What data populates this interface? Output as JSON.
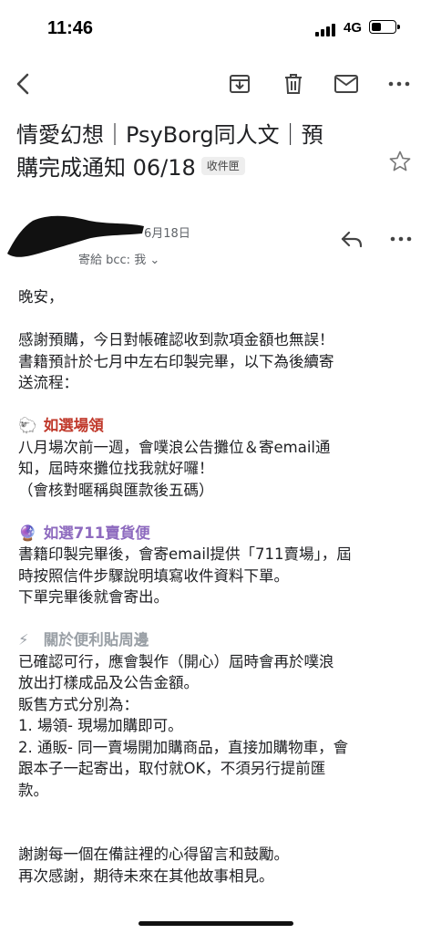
{
  "status_bar": {
    "time": "11:46",
    "network": "4G",
    "battery_level": 0.45
  },
  "toolbar": {
    "back_icon": "back-arrow-icon",
    "archive_icon": "archive-icon",
    "delete_icon": "trash-icon",
    "mark_unread_icon": "mail-icon",
    "more_icon": "more-horizontal-icon"
  },
  "email": {
    "subject_line1": "情愛幻想｜PsyBorg同人文｜預",
    "subject_line2": "購完成通知 06/18",
    "label": "收件匣",
    "date": "6月18日",
    "recipients": "寄給 bcc: 我 ⌄",
    "body": {
      "greeting": "晚安，",
      "intro": [
        "感謝預購，今日對帳確認收到款項金額也無誤！",
        "書籍預計於七月中左右印製完畢，以下為後續寄",
        "送流程："
      ],
      "section1": {
        "emoji": "🐑",
        "title": "如選場領",
        "lines": [
          "八月場次前一週，會噗浪公告攤位＆寄email通",
          "知，屆時來攤位找我就好囉！",
          "（會核對暱稱與匯款後五碼）"
        ]
      },
      "section2": {
        "emoji": "🔮",
        "title": "如選711賣貨便",
        "lines": [
          "書籍印製完畢後，會寄email提供「711賣場」，屆",
          "時按照信件步驟說明填寫收件資料下單。",
          "下單完畢後就會寄出。"
        ]
      },
      "section3": {
        "emoji": "⚡",
        "title": "關於便利貼周邊",
        "lines": [
          "已確認可行，應會製作（開心）屆時會再於噗浪",
          "放出打樣成品及公告金額。",
          "販售方式分別為：",
          "1. 場領- 現場加購即可。",
          "2. 通販- 同一賣場開加購商品，直接加購物車，會",
          "跟本子一起寄出，取付就OK，不須另行提前匯",
          "款。"
        ]
      },
      "closing": [
        "謝謝每一個在備註裡的心得留言和鼓勵。",
        "再次感謝，期待未來在其他故事相見。"
      ]
    }
  }
}
